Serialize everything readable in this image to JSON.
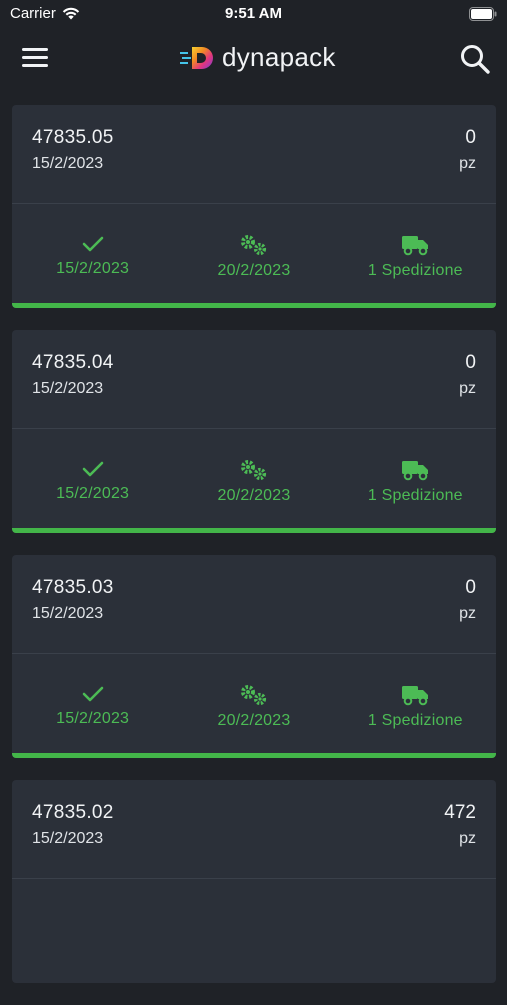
{
  "status_bar": {
    "carrier": "Carrier",
    "time": "9:51 AM"
  },
  "header": {
    "brand": "dynapack",
    "menu_icon": "hamburger-menu-icon",
    "search_icon": "search-icon"
  },
  "colors": {
    "accent_green": "#43b649",
    "card_bg": "#2b3039",
    "page_bg": "#1f2227"
  },
  "orders": [
    {
      "number": "47835.05",
      "date": "15/2/2023",
      "quantity": "0",
      "unit": "pz",
      "steps": {
        "confirmed": "15/2/2023",
        "production": "20/2/2023",
        "shipping": "1 Spedizione"
      },
      "progress": 1.0
    },
    {
      "number": "47835.04",
      "date": "15/2/2023",
      "quantity": "0",
      "unit": "pz",
      "steps": {
        "confirmed": "15/2/2023",
        "production": "20/2/2023",
        "shipping": "1 Spedizione"
      },
      "progress": 1.0
    },
    {
      "number": "47835.03",
      "date": "15/2/2023",
      "quantity": "0",
      "unit": "pz",
      "steps": {
        "confirmed": "15/2/2023",
        "production": "20/2/2023",
        "shipping": "1 Spedizione"
      },
      "progress": 1.0
    },
    {
      "number": "47835.02",
      "date": "15/2/2023",
      "quantity": "472",
      "unit": "pz",
      "steps": {
        "confirmed": "",
        "production": "",
        "shipping": ""
      },
      "progress": 0
    }
  ]
}
